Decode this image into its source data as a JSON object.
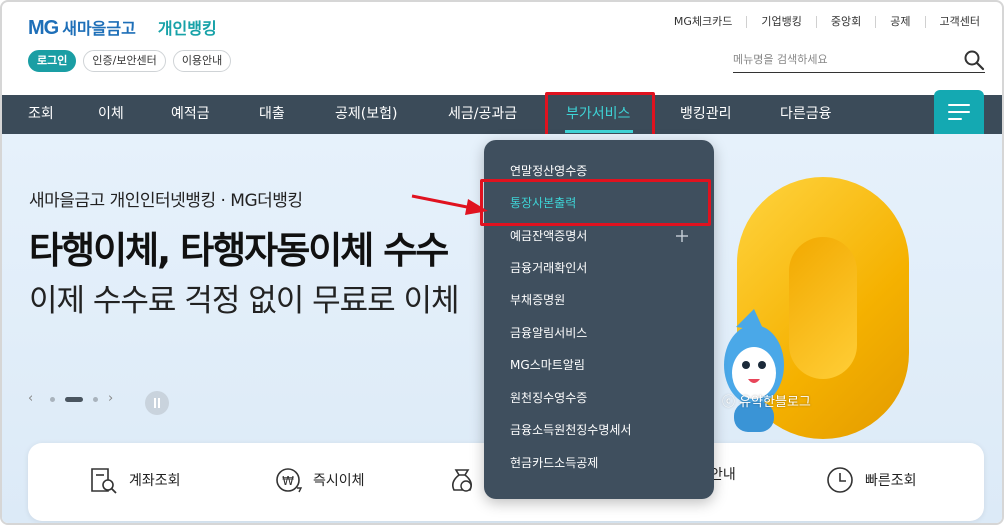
{
  "header": {
    "logo_mg": "MG",
    "logo_name": "새마을금고",
    "logo_sub": "개인뱅킹",
    "util_links": [
      "MG체크카드",
      "기업뱅킹",
      "중앙회",
      "공제",
      "고객센터"
    ],
    "auth_buttons": [
      "로그인",
      "인증/보안센터",
      "이용안내"
    ],
    "search_placeholder": "메뉴명을 검색하세요"
  },
  "nav": {
    "items": [
      "조회",
      "이체",
      "예적금",
      "대출",
      "공제(보험)",
      "세금/공과금",
      "부가서비스",
      "뱅킹관리",
      "다른금융"
    ],
    "active_index": 6
  },
  "dropdown": {
    "items": [
      "연말정산영수증",
      "통장사본출력",
      "예금잔액증명서",
      "금융거래확인서",
      "부채증명원",
      "금융알림서비스",
      "MG스마트알림",
      "원천징수영수증",
      "금융소득원천징수명세서",
      "현금카드소득공제"
    ],
    "highlighted_index": 1,
    "expandable_index": 2
  },
  "hero": {
    "subtitle": "새마을금고 개인인터넷뱅킹 · MG더뱅킹",
    "title": "타행이체, 타행자동이체 수수",
    "desc": "이제 수수료 걱정 없이 무료로 이체"
  },
  "watermark": "ⓒ 유약한블로그",
  "quick": {
    "items": [
      "계좌조회",
      "즉시이체",
      "",
      "안내",
      "빠른조회"
    ]
  },
  "colors": {
    "brand_blue": "#1e6fb8",
    "teal": "#1a9ea4",
    "nav_bg": "#3b4b59",
    "active_teal": "#3ed3d6",
    "highlight_red": "#e0121f"
  }
}
